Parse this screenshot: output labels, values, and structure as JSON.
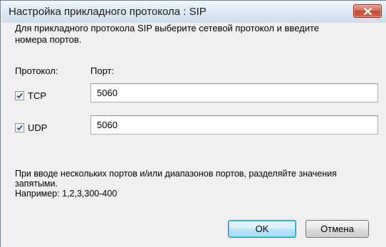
{
  "window": {
    "title": "Настройка прикладного протокола : SIP"
  },
  "instructions": "Для прикладного протокола SIP выберите сетевой протокол и введите номера портов.",
  "columns": {
    "protocol": "Протокол:",
    "port": "Порт:"
  },
  "rows": [
    {
      "protocol": "TCP",
      "checked": true,
      "port": "5060"
    },
    {
      "protocol": "UDP",
      "checked": true,
      "port": "5060"
    }
  ],
  "hint": {
    "line1": "При вводе нескольких портов и/или диапазонов портов, разделяйте значения запятыми.",
    "line2": "Например: 1,2,3,300-400"
  },
  "buttons": {
    "ok": "OK",
    "cancel": "Отмена"
  },
  "icons": {
    "close": "close-icon",
    "check": "checkmark-icon"
  }
}
